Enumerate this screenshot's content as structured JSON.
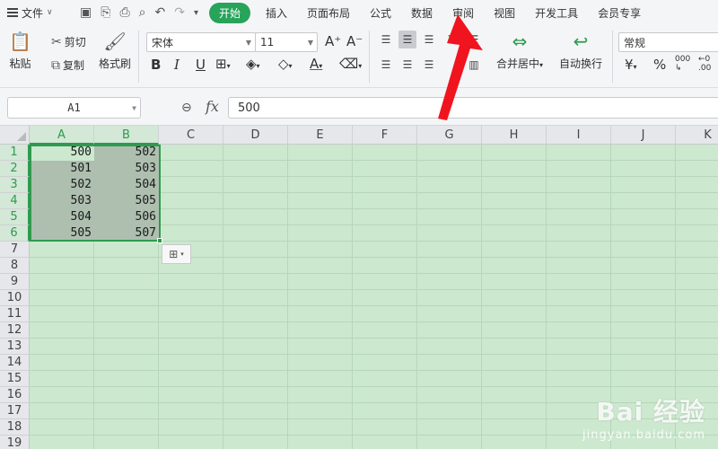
{
  "menubar": {
    "file_label": "文件",
    "tabs": [
      "开始",
      "插入",
      "页面布局",
      "公式",
      "数据",
      "审阅",
      "视图",
      "开发工具",
      "会员专享"
    ],
    "active_tab": "开始"
  },
  "ribbon": {
    "paste": "粘贴",
    "cut": "剪切",
    "copy": "复制",
    "format_painter": "格式刷",
    "font_name": "宋体",
    "font_size": "11",
    "bold": "B",
    "italic": "I",
    "underline": "U",
    "merge_center": "合并居中",
    "wrap_text": "自动换行",
    "number_format": "常规",
    "currency": "¥",
    "percent": "%",
    "thousands": "000"
  },
  "formula_bar": {
    "name_box": "A1",
    "fx": "fx",
    "value": "500"
  },
  "grid": {
    "columns": [
      "A",
      "B",
      "C",
      "D",
      "E",
      "F",
      "G",
      "H",
      "I",
      "J",
      "K"
    ],
    "rows": [
      "1",
      "2",
      "3",
      "4",
      "5",
      "6",
      "7",
      "8",
      "9",
      "10",
      "11",
      "12",
      "13",
      "14",
      "15",
      "16",
      "17",
      "18",
      "19"
    ],
    "data": [
      [
        "500",
        "502"
      ],
      [
        "501",
        "503"
      ],
      [
        "502",
        "504"
      ],
      [
        "503",
        "505"
      ],
      [
        "504",
        "506"
      ],
      [
        "505",
        "507"
      ]
    ]
  },
  "watermark": {
    "main": "Bai 经验",
    "sub": "jingyan.baidu.com"
  },
  "colors": {
    "accent": "#27a35a",
    "sheet_bg": "#cce8cf",
    "arrow": "#f0141e"
  }
}
